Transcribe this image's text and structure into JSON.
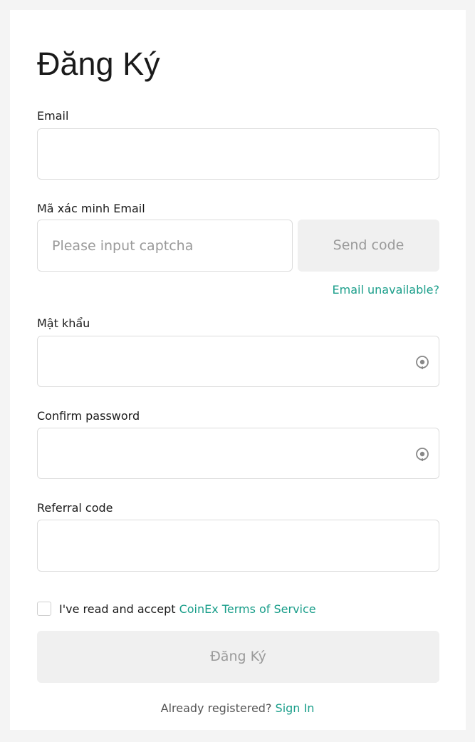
{
  "page_title": "Đăng Ký",
  "email": {
    "label": "Email",
    "value": "",
    "placeholder": ""
  },
  "email_code": {
    "label": "Mã xác minh Email",
    "placeholder": "Please input captcha",
    "value": "",
    "send_button": "Send code",
    "unavailable_link": "Email unavailable?"
  },
  "password": {
    "label": "Mật khẩu",
    "value": ""
  },
  "confirm_password": {
    "label": "Confirm password",
    "value": ""
  },
  "referral": {
    "label": "Referral code",
    "value": ""
  },
  "terms": {
    "checked": false,
    "text": "I've read and accept ",
    "link": "CoinEx Terms of Service"
  },
  "submit_label": "Đăng Ký",
  "footer": {
    "text": "Already registered? ",
    "link": "Sign In"
  },
  "colors": {
    "accent": "#1a9e8a",
    "disabled_bg": "#f0f0f0",
    "disabled_text": "#9a9a9a"
  },
  "icons": {
    "password_toggle": "eye-toggle-icon"
  }
}
